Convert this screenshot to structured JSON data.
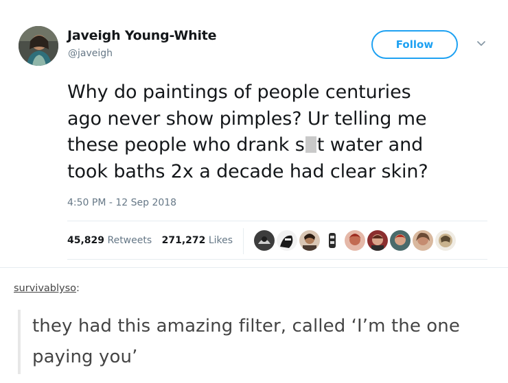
{
  "tweet": {
    "author_name": "Javeigh Young-White",
    "author_handle": "@javeigh",
    "follow_label": "Follow",
    "text_lines": {
      "l1": "Why do paintings of people centuries",
      "l2": "ago never show pimples? Ur telling me",
      "l3_before": "these people who drank s",
      "l3_after": "t water and",
      "l4": "took baths 2x a decade had clear skin?"
    },
    "timestamp": "4:50 PM - 12 Sep 2018",
    "retweets_count": "45,829",
    "retweets_label": "Retweets",
    "likes_count": "271,272",
    "likes_label": "Likes",
    "icons": {
      "avatar": "author-avatar",
      "menu": "chevron-down-icon",
      "censor": "censored-word-block"
    },
    "liker_avatar_count": 9
  },
  "reblog": {
    "username": "survivablyso",
    "colon": ":",
    "text_line1": "they had this amazing filter, called ‘I’m the one",
    "text_line2": "paying you’"
  },
  "colors": {
    "accent": "#1da1f2",
    "text": "#14171a",
    "muted": "#657786",
    "divider": "#e6ecf0",
    "reblog_text": "#444444"
  }
}
